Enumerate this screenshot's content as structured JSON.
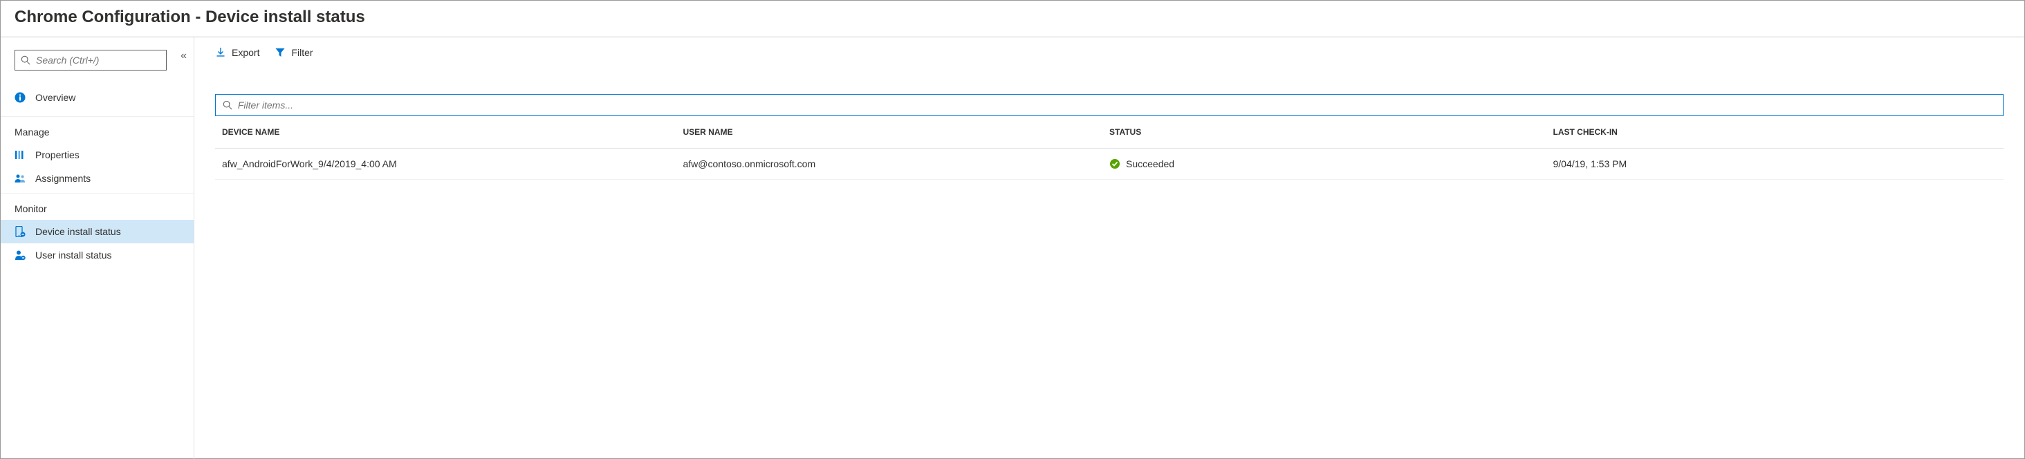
{
  "header": {
    "title": "Chrome Configuration - Device install status"
  },
  "sidebar": {
    "search_placeholder": "Search (Ctrl+/)",
    "collapse_symbol": "«",
    "overview_label": "Overview",
    "sections": {
      "manage": {
        "label": "Manage",
        "items": [
          {
            "label": "Properties"
          },
          {
            "label": "Assignments"
          }
        ]
      },
      "monitor": {
        "label": "Monitor",
        "items": [
          {
            "label": "Device install status"
          },
          {
            "label": "User install status"
          }
        ]
      }
    }
  },
  "toolbar": {
    "export_label": "Export",
    "filter_label": "Filter"
  },
  "main": {
    "filter_placeholder": "Filter items...",
    "columns": {
      "device": "DEVICE NAME",
      "user": "USER NAME",
      "status": "STATUS",
      "checkin": "LAST CHECK-IN"
    },
    "rows": [
      {
        "device": "afw_AndroidForWork_9/4/2019_4:00 AM",
        "user": "afw@contoso.onmicrosoft.com",
        "status": "Succeeded",
        "checkin": "9/04/19, 1:53 PM"
      }
    ]
  }
}
